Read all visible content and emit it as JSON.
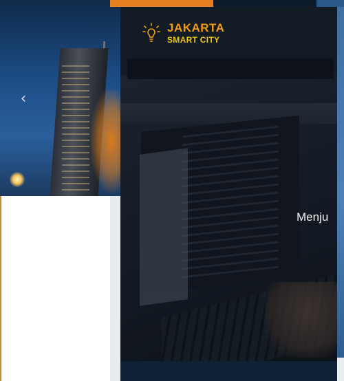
{
  "brand": {
    "name_line1": "JAKARTA",
    "name_line2": "SMART CITY",
    "icon": "lightbulb-icon",
    "accent_color": "#f39c12"
  },
  "carousel": {
    "prev_glyph": "‹",
    "caption": "Menju"
  },
  "colors": {
    "panel": "#1b2530",
    "orange_accent": "#e67e22",
    "bottom_bar": "#0f2235"
  }
}
